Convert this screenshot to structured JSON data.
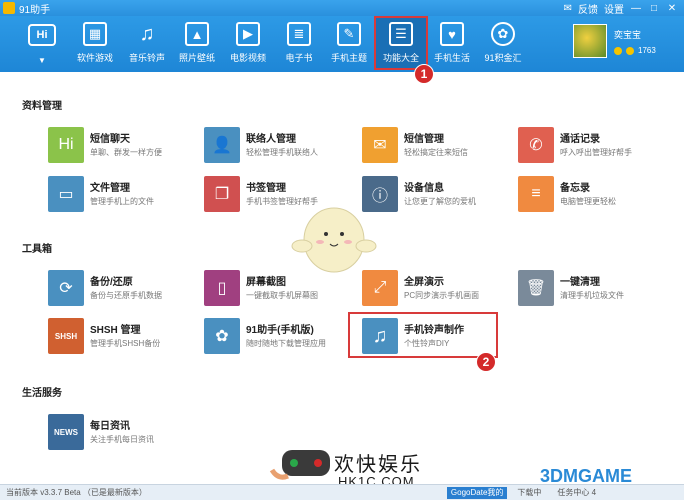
{
  "app": {
    "title": "91助手",
    "feedback": "反馈",
    "settings": "设置"
  },
  "toolbar": {
    "hi": "Hi",
    "items": [
      {
        "label": "软件游戏",
        "icon": "grid-icon"
      },
      {
        "label": "音乐铃声",
        "icon": "music-icon"
      },
      {
        "label": "照片壁纸",
        "icon": "photo-icon"
      },
      {
        "label": "电影视频",
        "icon": "film-icon"
      },
      {
        "label": "电子书",
        "icon": "book-icon"
      },
      {
        "label": "手机主题",
        "icon": "theme-icon"
      },
      {
        "label": "功能大全",
        "icon": "toolbox-icon"
      },
      {
        "label": "手机生活",
        "icon": "bag-icon"
      },
      {
        "label": "91积金汇",
        "icon": "coin-icon"
      }
    ],
    "active": "功能大全"
  },
  "user": {
    "name": "奕宝宝",
    "points": "1763"
  },
  "markers": {
    "m1": "1",
    "m2": "2"
  },
  "sections": {
    "data": {
      "title": "资料管理",
      "items": [
        {
          "name": "短信聊天",
          "desc": "单聊、群发一样方便",
          "color": "#8bc34a",
          "icon": "chat-icon"
        },
        {
          "name": "联络人管理",
          "desc": "轻松管理手机联络人",
          "color": "#4a90c0",
          "icon": "contact-icon"
        },
        {
          "name": "短信管理",
          "desc": "轻松搞定往来短信",
          "color": "#f0a030",
          "icon": "mail-icon"
        },
        {
          "name": "通话记录",
          "desc": "呼入呼出管理好帮手",
          "color": "#e06050",
          "icon": "phone-icon"
        },
        {
          "name": "文件管理",
          "desc": "管理手机上的文件",
          "color": "#4a90c0",
          "icon": "folder-icon"
        },
        {
          "name": "书签管理",
          "desc": "手机书签管理好帮手",
          "color": "#d05050",
          "icon": "bookmark-icon"
        },
        {
          "name": "设备信息",
          "desc": "让您更了解您的爱机",
          "color": "#4a6a8a",
          "icon": "device-icon"
        },
        {
          "name": "备忘录",
          "desc": "电脑管理更轻松",
          "color": "#f08a40",
          "icon": "memo-icon"
        }
      ]
    },
    "tools": {
      "title": "工具箱",
      "items": [
        {
          "name": "备份/还原",
          "desc": "备份与还原手机数据",
          "color": "#4a90c0",
          "icon": "backup-icon"
        },
        {
          "name": "屏幕截图",
          "desc": "一键截取手机屏幕图",
          "color": "#a04080",
          "icon": "screenshot-icon"
        },
        {
          "name": "全屏演示",
          "desc": "PC同步演示手机画面",
          "color": "#f08a40",
          "icon": "fullscreen-icon"
        },
        {
          "name": "一键清理",
          "desc": "清理手机垃圾文件",
          "color": "#7a8a9a",
          "icon": "trash-icon"
        },
        {
          "name": "SHSH 管理",
          "desc": "管理手机SHSH备份",
          "color": "#d06030",
          "icon": "shsh-icon"
        },
        {
          "name": "91助手(手机版)",
          "desc": "随时随地下载管理应用",
          "color": "#4a90c0",
          "icon": "91-icon"
        },
        {
          "name": "手机铃声制作",
          "desc": "个性铃声DIY",
          "color": "#4a90c0",
          "icon": "ringtone-icon"
        }
      ]
    },
    "life": {
      "title": "生活服务",
      "items": [
        {
          "name": "每日资讯",
          "desc": "关注手机每日资讯",
          "color": "#3a6a9a",
          "icon": "news-icon"
        }
      ]
    }
  },
  "status": {
    "version": "当前版本 v3.3.7 Beta （已是最新版本）",
    "task": "GogoDate我的",
    "download": "下载中",
    "tasks": "任务中心 4"
  },
  "watermark": {
    "text1": "欢快娱乐",
    "text2": "HK1C.COM",
    "right": "3DMGAME"
  }
}
